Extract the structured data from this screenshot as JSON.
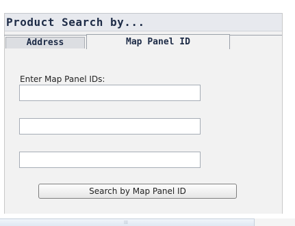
{
  "panel": {
    "title": "Product Search by..."
  },
  "tabs": [
    {
      "label": "Address",
      "selected": false
    },
    {
      "label": "Map Panel ID",
      "selected": true
    }
  ],
  "form": {
    "label": "Enter Map Panel IDs:",
    "inputs": [
      {
        "value": "",
        "placeholder": ""
      },
      {
        "value": "",
        "placeholder": ""
      },
      {
        "value": "",
        "placeholder": ""
      }
    ],
    "submit_label": "Search by Map Panel ID"
  },
  "scrollbar": {
    "grip": "⁞⁞⁞"
  },
  "colors": {
    "title_text": "#1d2b46",
    "panel_background": "#f2f2f2",
    "title_background": "#e7e9ee",
    "scrollbar_background": "#dfe8f3"
  }
}
